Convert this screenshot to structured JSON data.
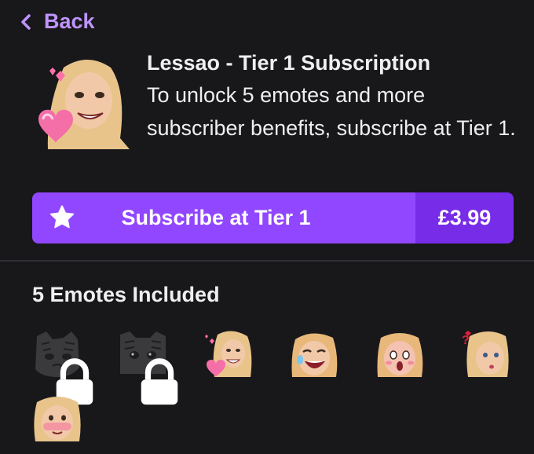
{
  "back": {
    "label": "Back"
  },
  "subscription": {
    "title": "Lessao - Tier 1 Subscription",
    "description": "To unlock 5 emotes and more subscriber benefits, subscribe at Tier 1.",
    "button_label": "Subscribe at Tier 1",
    "price": "£3.99"
  },
  "emotes": {
    "heading": "5 Emotes Included",
    "items": [
      {
        "icon": "locked-cat-emote-icon",
        "locked": true
      },
      {
        "icon": "locked-cat-emote-icon",
        "locked": true
      },
      {
        "icon": "heart-face-emote-icon",
        "locked": false
      },
      {
        "icon": "laughing-face-emote-icon",
        "locked": false
      },
      {
        "icon": "shocked-face-emote-icon",
        "locked": false
      },
      {
        "icon": "confused-face-emote-icon",
        "locked": false
      },
      {
        "icon": "blushing-face-emote-icon",
        "locked": false
      }
    ]
  },
  "colors": {
    "background": "#18181b",
    "accent": "#9147ff",
    "accent_dark": "#772ce8",
    "back_link": "#bf94ff"
  }
}
